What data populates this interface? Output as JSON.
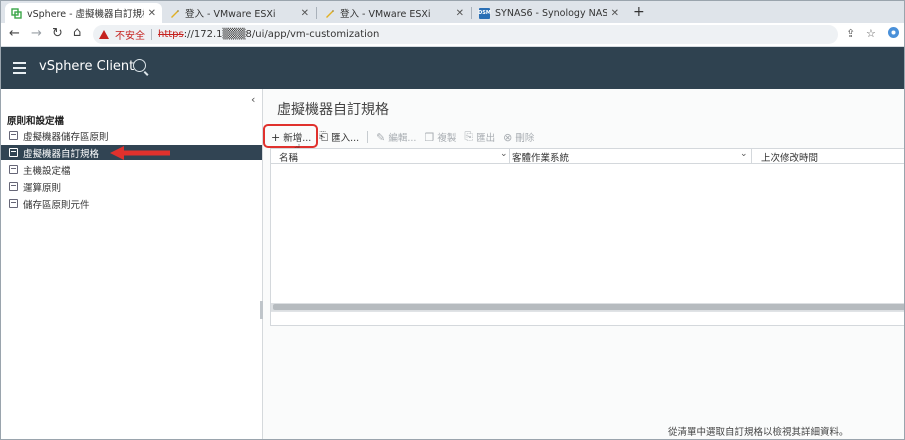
{
  "browser": {
    "tabs": [
      {
        "title": "vSphere - 虛擬機器自訂規格",
        "active": true,
        "icon": "vsphere-icon"
      },
      {
        "title": "登入 - VMware ESXi",
        "active": false,
        "icon": "pencil-favicon-icon"
      },
      {
        "title": "登入 - VMware ESXi",
        "active": false,
        "icon": "pencil-favicon-icon"
      },
      {
        "title": "SYNAS6 - Synology NAS",
        "active": false,
        "icon": "dsm-icon"
      }
    ],
    "dsm_badge": "DSM",
    "insecure_label": "不安全",
    "url_scheme": "https",
    "url_rest": "://172.1▒▒▒8/ui/app/vm-customization"
  },
  "app": {
    "title": "vSphere Client"
  },
  "sidebar": {
    "section_title": "原則和設定檔",
    "items": [
      {
        "label": "虛擬機器儲存區原則",
        "selected": false
      },
      {
        "label": "虛擬機器自訂規格",
        "selected": true
      },
      {
        "label": "主機設定檔",
        "selected": false
      },
      {
        "label": "運算原則",
        "selected": false
      },
      {
        "label": "儲存區原則元件",
        "selected": false
      }
    ]
  },
  "main": {
    "page_title": "虛擬機器自訂規格",
    "toolbar": {
      "new_label": "新增...",
      "import_label": "匯入...",
      "edit_label": "編輯...",
      "copy_label": "複製",
      "export_label": "匯出",
      "delete_label": "刪除"
    },
    "columns": [
      "名稱",
      "客體作業系統",
      "上次修改時間"
    ],
    "rows": [],
    "hint": "從清單中選取自訂規格以檢視其詳細資料。"
  },
  "colors": {
    "header_bg": "#2f4250",
    "selected_bg": "#314453",
    "annotation_red": "#e0312d",
    "insecure_red": "#c5221f"
  }
}
